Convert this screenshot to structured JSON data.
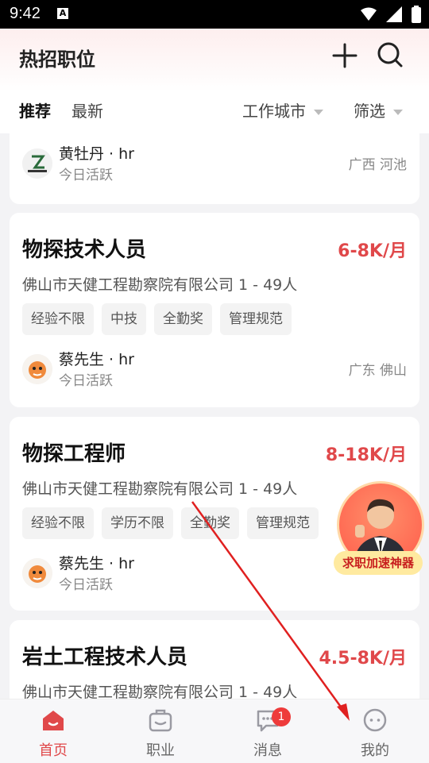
{
  "status_bar": {
    "time": "9:42",
    "notif_letter": "A"
  },
  "header": {
    "title": "热招职位",
    "tabs": [
      {
        "label": "推荐"
      },
      {
        "label": "最新"
      }
    ],
    "filters": [
      {
        "label": "工作城市"
      },
      {
        "label": "筛选"
      }
    ]
  },
  "jobs": [
    {
      "title": "",
      "salary": "",
      "company": "",
      "tags": [],
      "recruiter": {
        "name": "黄牡丹 · hr",
        "active": "今日活跃",
        "location": "广西 河池"
      }
    },
    {
      "title": "物探技术人员",
      "salary": "6-8K/月",
      "company": "佛山市天健工程勘察院有限公司 1 - 49人",
      "tags": [
        "经验不限",
        "中技",
        "全勤奖",
        "管理规范"
      ],
      "recruiter": {
        "name": "蔡先生 · hr",
        "active": "今日活跃",
        "location": "广东 佛山"
      }
    },
    {
      "title": "物探工程师",
      "salary": "8-18K/月",
      "company": "佛山市天健工程勘察院有限公司 1 - 49人",
      "tags": [
        "经验不限",
        "学历不限",
        "全勤奖",
        "管理规范"
      ],
      "recruiter": {
        "name": "蔡先生 · hr",
        "active": "今日活跃",
        "location": ""
      }
    },
    {
      "title": "岩土工程技术人员",
      "salary": "4.5-8K/月",
      "company": "佛山市天健工程勘察院有限公司 1 - 49人",
      "tags": [],
      "recruiter": null
    }
  ],
  "promo": {
    "label": "求职加速神器"
  },
  "tabbar": {
    "items": [
      {
        "label": "首页",
        "icon": "home-icon",
        "active": true
      },
      {
        "label": "职业",
        "icon": "briefcase-icon",
        "active": false
      },
      {
        "label": "消息",
        "icon": "message-icon",
        "active": false,
        "badge": "1"
      },
      {
        "label": "我的",
        "icon": "profile-icon",
        "active": false
      }
    ]
  },
  "colors": {
    "accent": "#e0484a",
    "badge": "#ee3b3b"
  }
}
